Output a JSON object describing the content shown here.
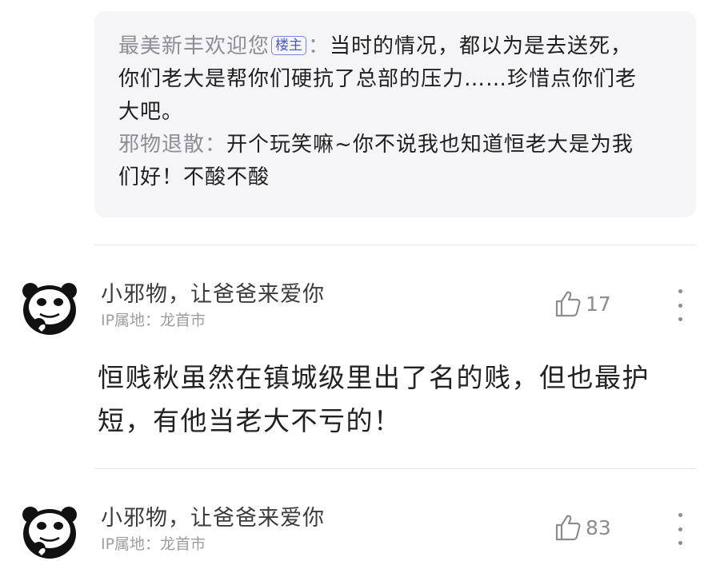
{
  "reply_box": {
    "lines": [
      {
        "author": "最美新丰欢迎您",
        "badge": "楼主",
        "separator": "：",
        "text_line1": "当时的情况，都以为是去送死，",
        "text_line2": "你们老大是帮你们硬抗了总部的压力……珍惜点你们老",
        "text_line3": "大吧。"
      },
      {
        "author": "邪物退散",
        "separator": "：",
        "text_line1": "开个玩笑嘛~你不说我也知道恒老大是为我",
        "text_line2": "们好！不酸不酸"
      }
    ]
  },
  "comments": [
    {
      "username": "小邪物，让爸爸来爱你",
      "ip": "IP属地：龙首市",
      "likes": "17",
      "text": "恒贱秋虽然在镇城级里出了名的贱，但也最护短，有他当老大不亏的！",
      "avatar_icon": "panda-meme-avatar-icon"
    },
    {
      "username": "小邪物，让爸爸来爱你",
      "ip": "IP属地：龙首市",
      "likes": "83",
      "avatar_icon": "panda-meme-avatar-icon"
    }
  ],
  "icons": {
    "like": "thumbs-up-icon",
    "more": "more-vertical-icon"
  },
  "colors": {
    "badge": "#4c59c9",
    "muted": "#8d8d93",
    "reply_bg": "#f5f5f7"
  }
}
